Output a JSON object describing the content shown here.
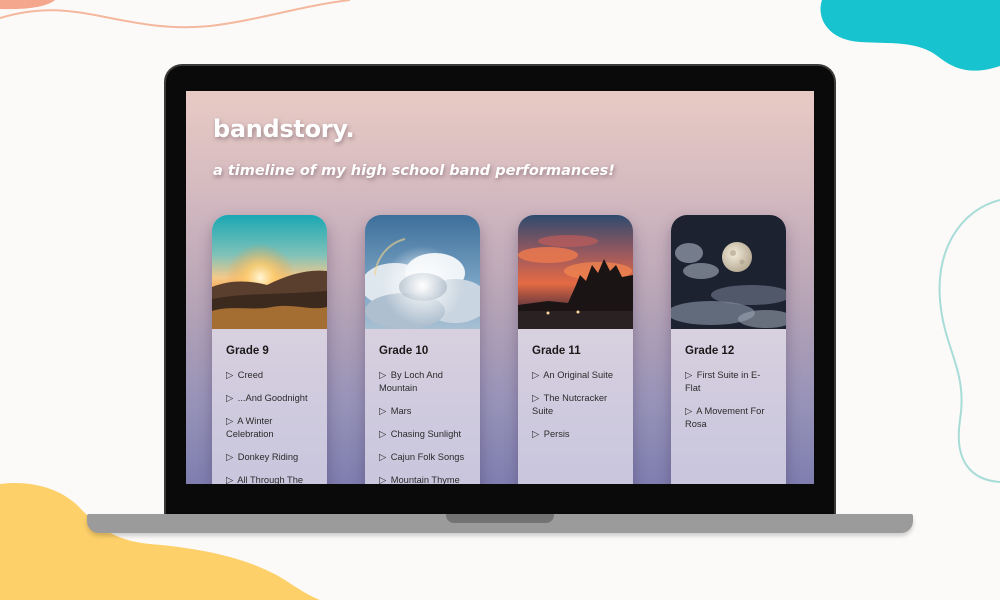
{
  "site": {
    "title": "bandstory.",
    "subtitle": "a timeline of my high school band performances!"
  },
  "cards": [
    {
      "grade": "Grade 9",
      "image_icon": "sunset-photo",
      "songs": [
        "Creed",
        "...And Goodnight",
        "A Winter Celebration",
        "Donkey Riding",
        "All Through The"
      ]
    },
    {
      "grade": "Grade 10",
      "image_icon": "clouds-photo",
      "songs": [
        "By Loch And Mountain",
        "Mars",
        "Chasing Sunlight",
        "Cajun Folk Songs",
        "Mountain Thyme"
      ]
    },
    {
      "grade": "Grade 11",
      "image_icon": "red-sky-photo",
      "songs": [
        "An Original Suite",
        "The Nutcracker Suite",
        "Persis"
      ]
    },
    {
      "grade": "Grade 12",
      "image_icon": "moon-photo",
      "songs": [
        "First Suite in E-Flat",
        "A Movement For Rosa"
      ]
    }
  ],
  "bullet_glyph": "▷",
  "colors": {
    "page_background": "#fcfaf8",
    "blob_orange": "#f4b89f",
    "blob_teal": "#17c3cf",
    "blob_yellow": "#fdd06a",
    "screen_top": "#e8cbc4",
    "screen_bottom": "#7f7eaf"
  }
}
